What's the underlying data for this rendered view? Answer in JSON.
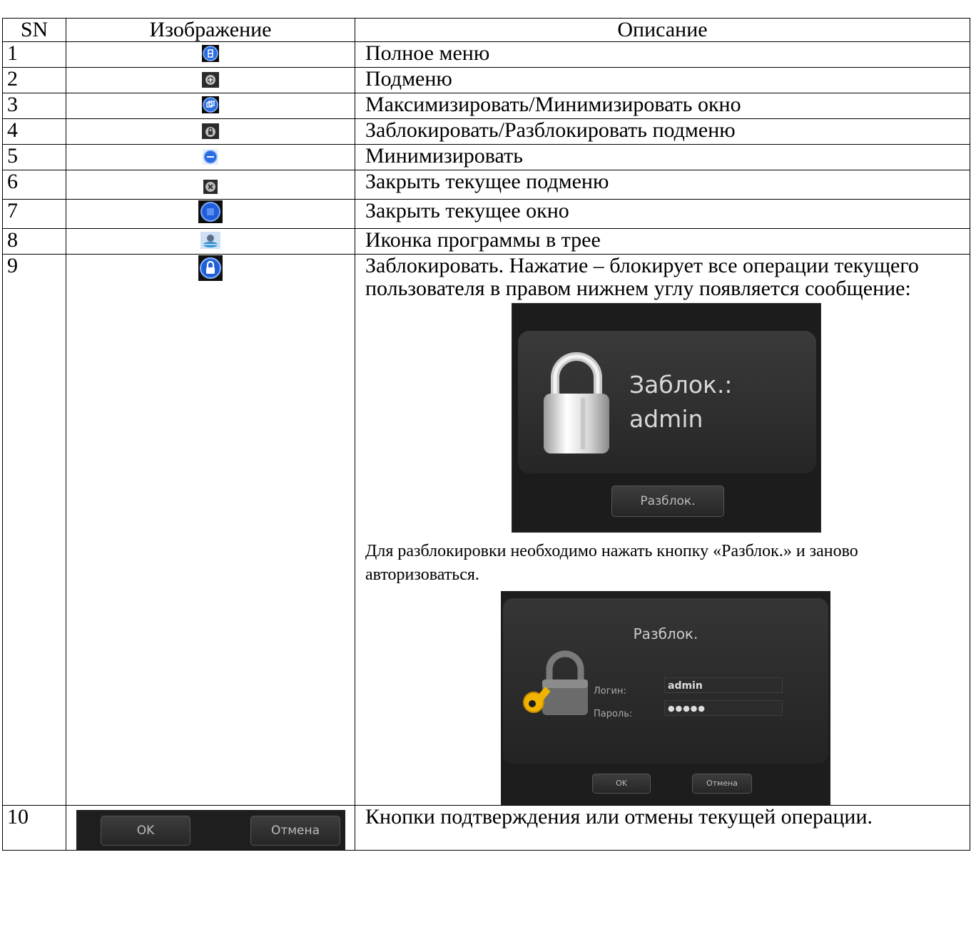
{
  "table": {
    "headers": [
      "SN",
      "Изображение",
      "Описание"
    ],
    "rows": [
      {
        "sn": "1",
        "icon": "menu-icon",
        "text": "Полное меню"
      },
      {
        "sn": "2",
        "icon": "submenu-icon",
        "text": "Подменю"
      },
      {
        "sn": "3",
        "icon": "maximize-icon",
        "text": "Максимизировать/Минимизировать окно"
      },
      {
        "sn": "4",
        "icon": "lock-submenu-icon",
        "text": "Заблокировать/Разблокировать подменю"
      },
      {
        "sn": "5",
        "icon": "minimize-icon",
        "text": "Минимизировать"
      },
      {
        "sn": "6",
        "icon": "close-submenu-icon",
        "text": "Закрыть текущее подменю"
      },
      {
        "sn": "7",
        "icon": "close-window-icon",
        "text": "Закрыть текущее окно"
      },
      {
        "sn": "8",
        "icon": "tray-icon",
        "text": "Иконка программы в трее"
      },
      {
        "sn": "9",
        "icon": "lock-icon",
        "text": "Заблокировать. Нажатие – блокирует все операции текущего пользователя в правом нижнем углу появляется сообщение:"
      },
      {
        "sn": "10",
        "icon": "ok-cancel-buttons",
        "text": "Кнопки подтверждения или отмены текущей операции."
      }
    ]
  },
  "lock_dialog": {
    "label": "Заблок.:",
    "user": "admin",
    "unlock_button": "Разблок."
  },
  "hint_text": "Для разблокировки необходимо нажать кнопку «Разблок.» и заново авторизоваться.",
  "unlock_dialog": {
    "title": "Разблок.",
    "login_label": "Логин:",
    "login_value": "admin",
    "password_label": "Пароль:",
    "password_value": "●●●●●",
    "ok_button": "OK",
    "cancel_button": "Отмена"
  },
  "row10_buttons": {
    "ok": "OK",
    "cancel": "Отмена"
  },
  "colors": {
    "icon_blue": "#1f5fd8",
    "dialog_bg": "#1c1c1c"
  }
}
